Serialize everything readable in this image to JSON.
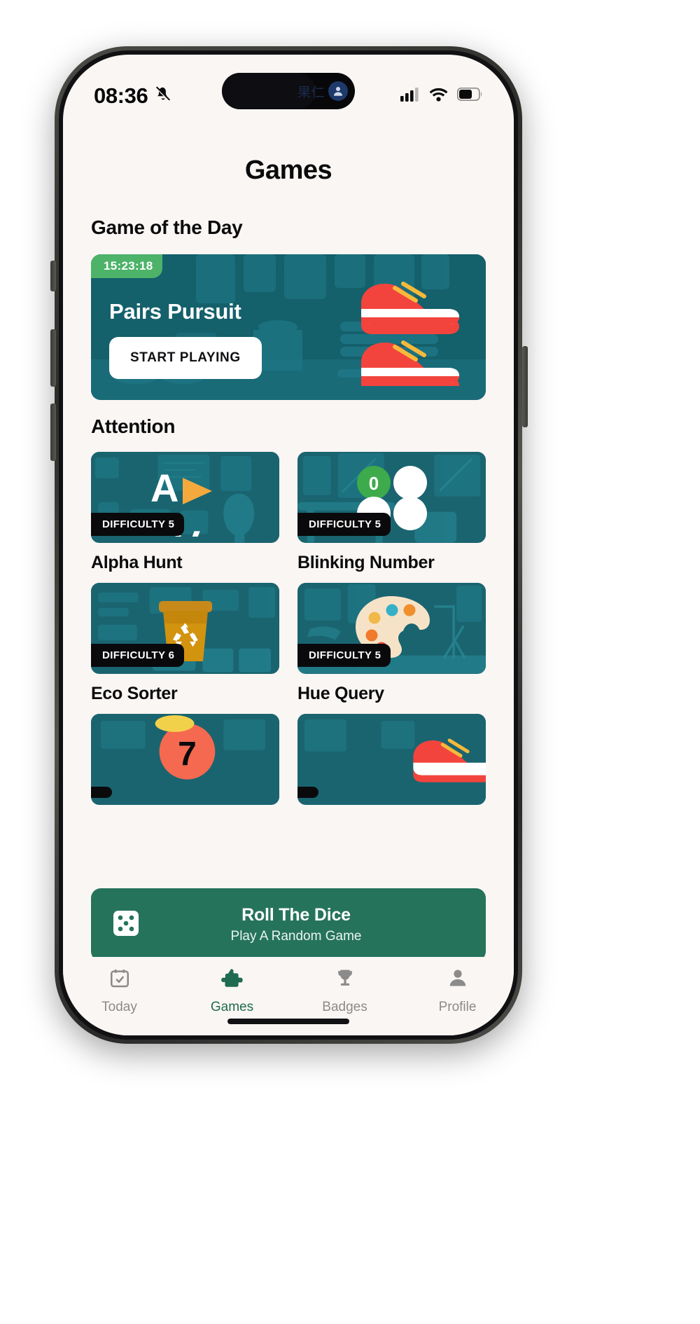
{
  "status_bar": {
    "time": "08:36",
    "bell_icon": "bell-slash-icon",
    "island_text": "果仁",
    "island_avatar_icon": "person-icon",
    "signal_icon": "cellular-signal-icon",
    "wifi_icon": "wifi-icon",
    "battery_icon": "battery-icon",
    "battery_level": 62
  },
  "header": {
    "title": "Games"
  },
  "game_of_the_day": {
    "section_title": "Game of the Day",
    "timer": "15:23:18",
    "game_name": "Pairs Pursuit",
    "cta_label": "START PLAYING",
    "art_icon": "running-shoes-icon",
    "card_color": "#14606b",
    "timer_color": "#4cb369"
  },
  "attention": {
    "section_title": "Attention",
    "games": [
      {
        "title": "Alpha Hunt",
        "difficulty_label": "DIFFICULTY 5",
        "difficulty": 5,
        "art_icon": "letter-a-arrow-icon"
      },
      {
        "title": "Blinking Number",
        "difficulty_label": "DIFFICULTY 5",
        "difficulty": 5,
        "art_icon": "numbered-circles-icon",
        "art_number": "0"
      },
      {
        "title": "Eco Sorter",
        "difficulty_label": "DIFFICULTY 6",
        "difficulty": 6,
        "art_icon": "recycle-bin-icon"
      },
      {
        "title": "Hue Query",
        "difficulty_label": "DIFFICULTY 5",
        "difficulty": 5,
        "art_icon": "paint-palette-icon"
      }
    ]
  },
  "dice_banner": {
    "title": "Roll The Dice",
    "subtitle": "Play A Random Game",
    "icon": "dice-five-icon",
    "color": "#26735c"
  },
  "tabs": [
    {
      "label": "Today",
      "icon": "calendar-check-icon",
      "active": false
    },
    {
      "label": "Games",
      "icon": "puzzle-piece-icon",
      "active": true
    },
    {
      "label": "Badges",
      "icon": "trophy-icon",
      "active": false
    },
    {
      "label": "Profile",
      "icon": "person-icon",
      "active": false
    }
  ],
  "theme": {
    "background": "#faf6f3",
    "accent_green": "#1f6b52",
    "card_teal": "#1a6470",
    "inactive_gray": "#8b8b8b"
  }
}
